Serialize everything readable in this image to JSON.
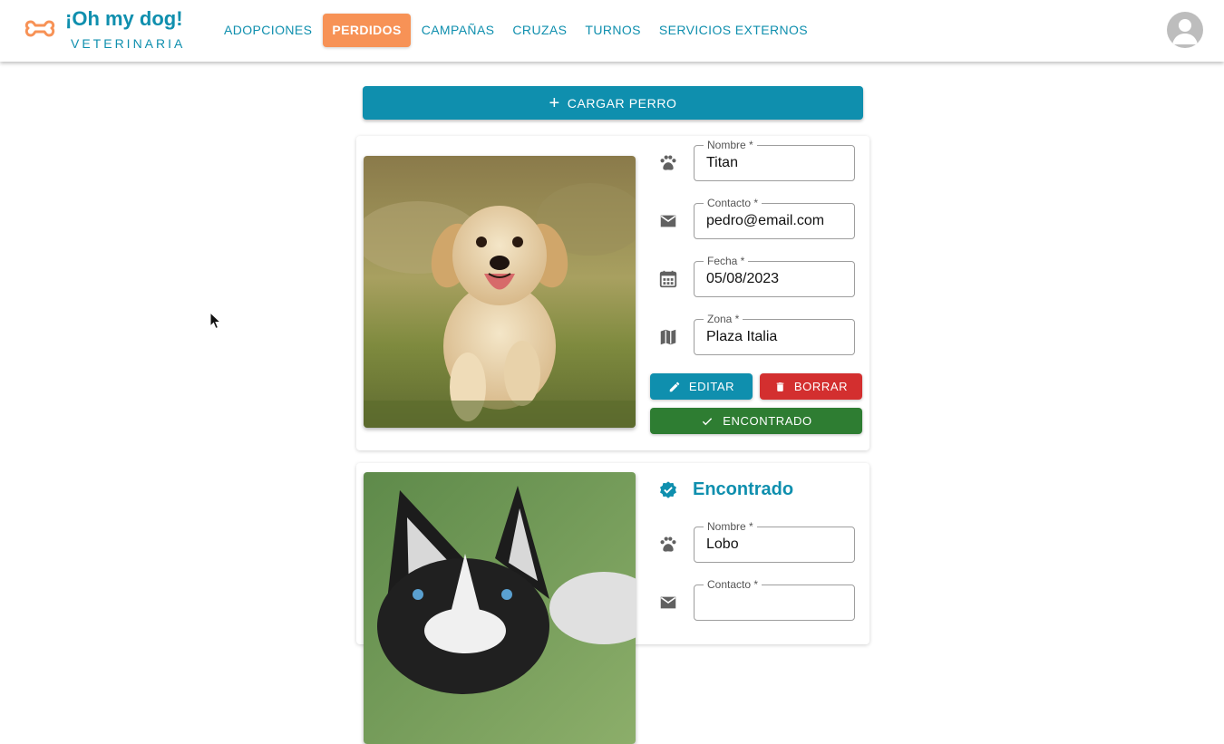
{
  "brand": {
    "title": "¡Oh my dog!",
    "subtitle": "VETERINARIA"
  },
  "nav": {
    "items": [
      {
        "label": "ADOPCIONES"
      },
      {
        "label": "PERDIDOS",
        "active": true
      },
      {
        "label": "CAMPAÑAS"
      },
      {
        "label": "CRUZAS"
      },
      {
        "label": "TURNOS"
      },
      {
        "label": "SERVICIOS EXTERNOS"
      }
    ]
  },
  "actions": {
    "add_label": "CARGAR PERRO"
  },
  "cards": [
    {
      "fields": {
        "name": {
          "label": "Nombre *",
          "value": "Titan"
        },
        "contact": {
          "label": "Contacto *",
          "value": "pedro@email.com"
        },
        "date": {
          "label": "Fecha *",
          "value": "05/08/2023"
        },
        "zone": {
          "label": "Zona *",
          "value": "Plaza Italia"
        }
      },
      "buttons": {
        "edit": "EDITAR",
        "delete": "BORRAR",
        "found": "ENCONTRADO"
      }
    },
    {
      "status": "Encontrado",
      "fields": {
        "name": {
          "label": "Nombre *",
          "value": "Lobo"
        },
        "contact": {
          "label": "Contacto *"
        }
      }
    }
  ],
  "colors": {
    "primary": "#0f8fae",
    "accent": "#f79256",
    "danger": "#d32f2f",
    "success": "#2e7d32"
  }
}
